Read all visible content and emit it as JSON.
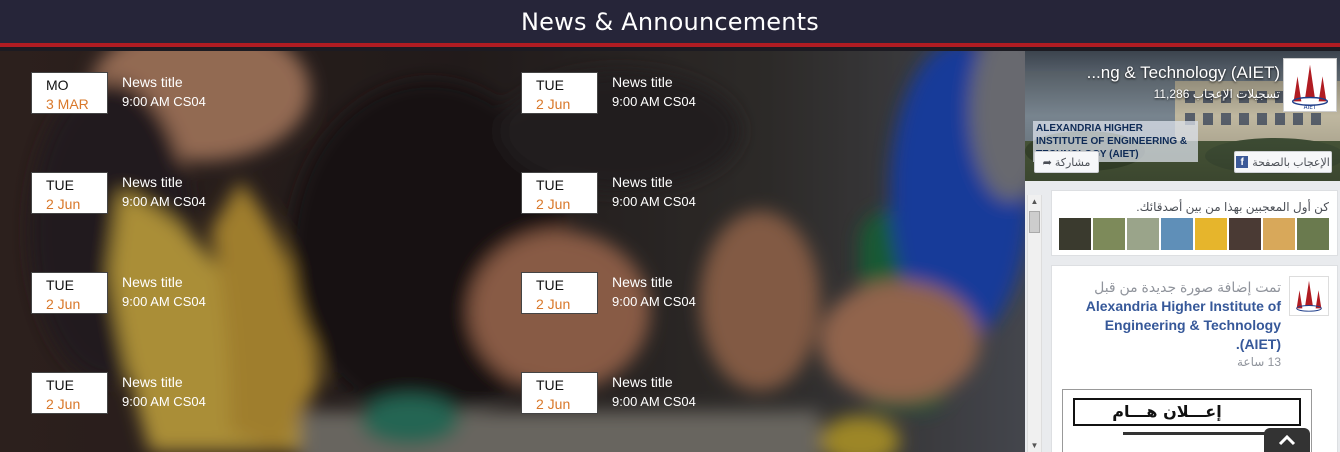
{
  "header": {
    "title": "News & Announcements"
  },
  "news": [
    {
      "day": "MO",
      "date": "3 MAR",
      "title": "News title",
      "time": "9:00 AM CS04"
    },
    {
      "day": "TUE",
      "date": "2 Jun",
      "title": "News title",
      "time": "9:00 AM CS04"
    },
    {
      "day": "TUE",
      "date": "2 Jun",
      "title": "News title",
      "time": "9:00 AM CS04"
    },
    {
      "day": "TUE",
      "date": "2 Jun",
      "title": "News title",
      "time": "9:00 AM CS04"
    },
    {
      "day": "TUE",
      "date": "2 Jun",
      "title": "News title",
      "time": "9:00 AM CS04"
    },
    {
      "day": "TUE",
      "date": "2 Jun",
      "title": "News title",
      "time": "9:00 AM CS04"
    },
    {
      "day": "TUE",
      "date": "2 Jun",
      "title": "News title",
      "time": "9:00 AM CS04"
    },
    {
      "day": "TUE",
      "date": "2 Jun",
      "title": "News title",
      "time": "9:00 AM CS04"
    }
  ],
  "facebook": {
    "page_name": "...ng & Technology (AIET)",
    "likes": "11,286 تسجيلات الإعجاب",
    "cover_sign": "ALEXANDRIA HIGHER INSTITUTE OF ENGINEERING & TECHNOLOGY (AIET)",
    "like_button": "الإعجاب بالصفحة",
    "share_button": "مشاركة",
    "friends_prompt": "كن أول المعجبين بهذا من بين أصدقائك.",
    "post_header": "تمت إضافة صورة جديدة من قبل",
    "post_page": "Alexandria Higher Institute of Engineering & Technology (AIET).",
    "post_time": "13 ساعة",
    "post_image_text": "إعـــلان هـــام"
  },
  "colors": {
    "header_bg": "#262539",
    "header_accent": "#b01c22",
    "date_accent": "#d9782a",
    "fb_link": "#365899"
  },
  "icons": {
    "facebook": "facebook-f-icon",
    "share": "share-arrow-icon",
    "back_to_top": "chevron-up-icon"
  }
}
